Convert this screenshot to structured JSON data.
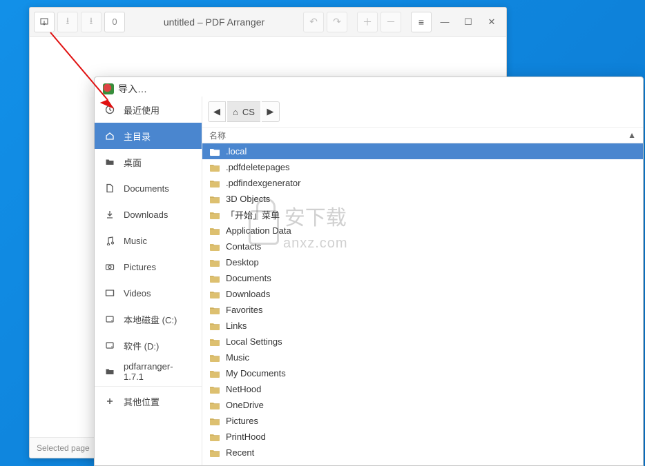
{
  "main_window": {
    "title": "untitled – PDF Arranger",
    "counter": "0",
    "status": "Selected page"
  },
  "dialog": {
    "title": "导入…",
    "path_current": "CS",
    "list_header": "名称",
    "sort_indicator": "▲"
  },
  "sidebar": [
    {
      "icon": "clock",
      "label": "最近使用"
    },
    {
      "icon": "home",
      "label": "主目录",
      "active": true
    },
    {
      "icon": "folder",
      "label": "桌面"
    },
    {
      "icon": "doc",
      "label": "Documents"
    },
    {
      "icon": "download",
      "label": "Downloads"
    },
    {
      "icon": "music",
      "label": "Music"
    },
    {
      "icon": "camera",
      "label": "Pictures"
    },
    {
      "icon": "video",
      "label": "Videos"
    },
    {
      "icon": "disk",
      "label": "本地磁盘 (C:)"
    },
    {
      "icon": "disk",
      "label": "软件 (D:)"
    },
    {
      "icon": "folder",
      "label": "pdfarranger-1.7.1"
    }
  ],
  "sidebar_other": "其他位置",
  "files": [
    ".local",
    ".pdfdeletepages",
    ".pdfindexgenerator",
    "3D Objects",
    "「开始」菜单",
    "Application Data",
    "Contacts",
    "Desktop",
    "Documents",
    "Downloads",
    "Favorites",
    "Links",
    "Local Settings",
    "Music",
    "My Documents",
    "NetHood",
    "OneDrive",
    "Pictures",
    "PrintHood",
    "Recent"
  ],
  "watermark": {
    "main": "安下载",
    "sub": "anxz.com"
  }
}
